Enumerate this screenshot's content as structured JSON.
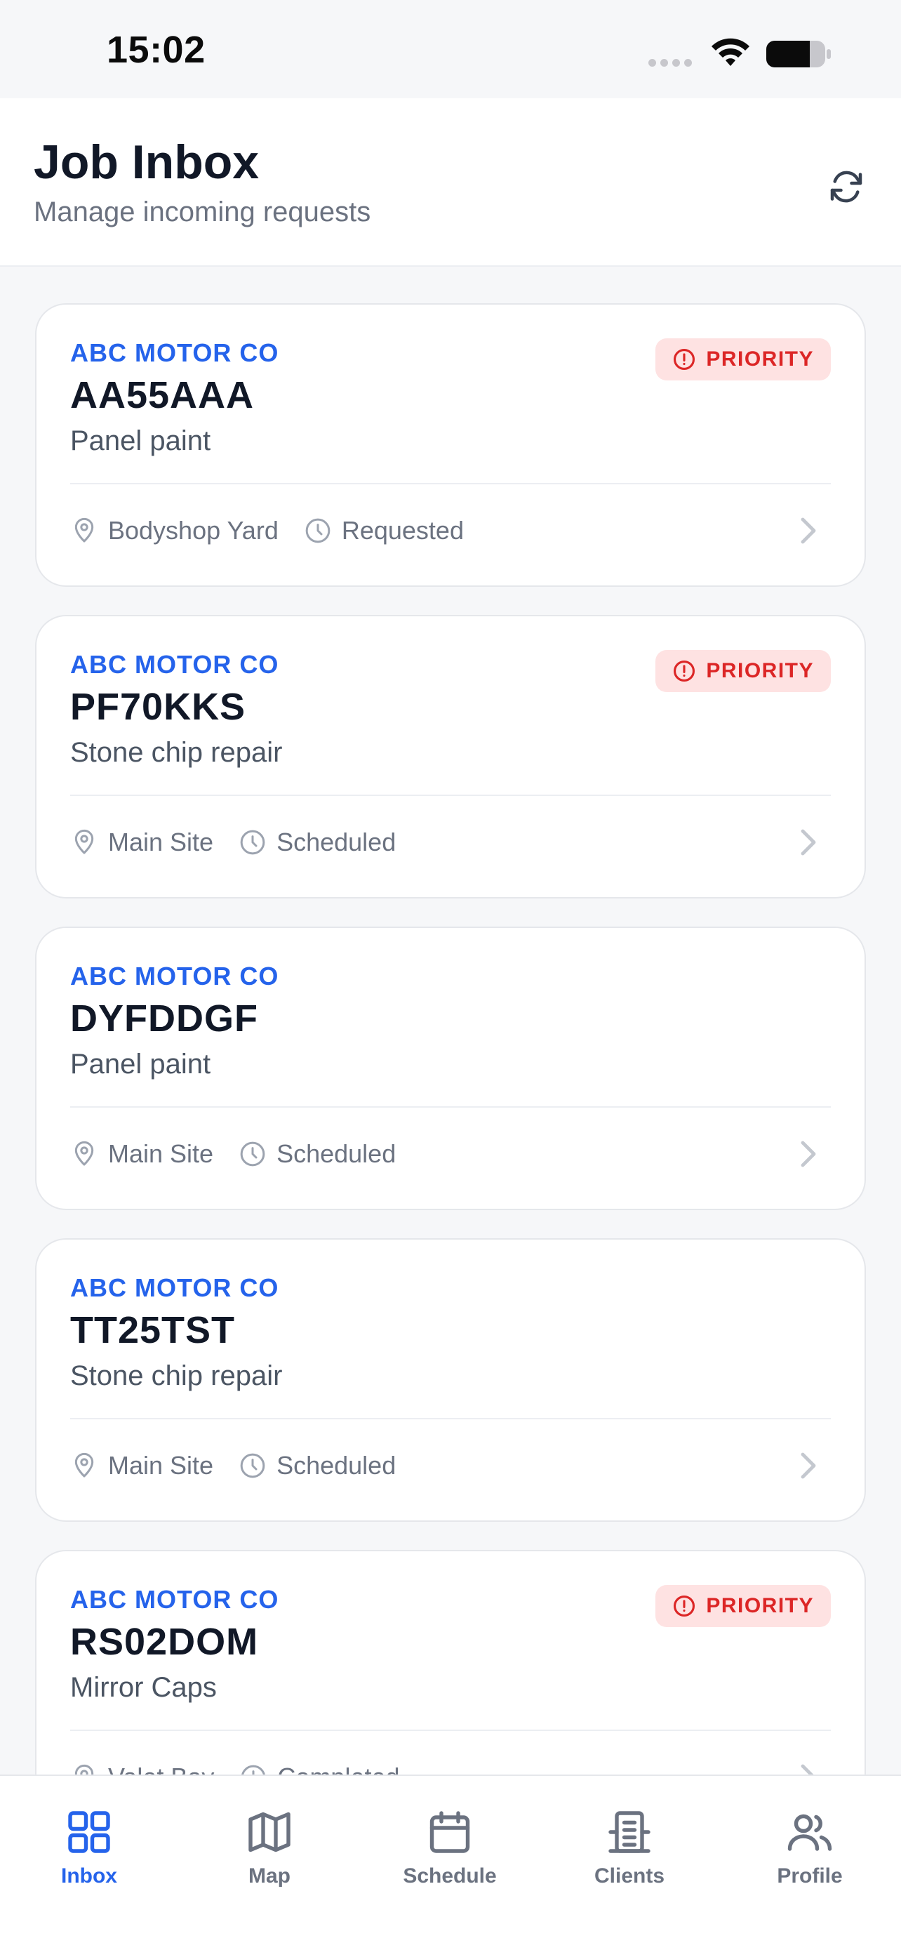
{
  "status_bar": {
    "time": "15:02"
  },
  "header": {
    "title": "Job Inbox",
    "subtitle": "Manage incoming requests",
    "refresh_icon": "refresh-icon"
  },
  "jobs": [
    {
      "client": "ABC MOTOR CO",
      "plate": "AA55AAA",
      "type": "Panel paint",
      "priority": true,
      "priority_label": "PRIORITY",
      "location": "Bodyshop Yard",
      "status": "Requested"
    },
    {
      "client": "ABC MOTOR CO",
      "plate": "PF70KKS",
      "type": "Stone chip repair",
      "priority": true,
      "priority_label": "PRIORITY",
      "location": "Main Site",
      "status": "Scheduled"
    },
    {
      "client": "ABC MOTOR CO",
      "plate": "DYFDDGF",
      "type": "Panel paint",
      "priority": false,
      "location": "Main Site",
      "status": "Scheduled"
    },
    {
      "client": "ABC MOTOR CO",
      "plate": "TT25TST",
      "type": "Stone chip repair",
      "priority": false,
      "location": "Main Site",
      "status": "Scheduled"
    },
    {
      "client": "ABC MOTOR CO",
      "plate": "RS02DOM",
      "type": "Mirror Caps",
      "priority": true,
      "priority_label": "PRIORITY",
      "location": "Valet Bay",
      "status": "Completed"
    }
  ],
  "tab_bar": {
    "tabs": [
      {
        "label": "Inbox",
        "icon": "grid-icon",
        "active": true
      },
      {
        "label": "Map",
        "icon": "map-icon",
        "active": false
      },
      {
        "label": "Schedule",
        "icon": "calendar-icon",
        "active": false
      },
      {
        "label": "Clients",
        "icon": "building-icon",
        "active": false
      },
      {
        "label": "Profile",
        "icon": "users-icon",
        "active": false
      }
    ]
  },
  "colors": {
    "accent": "#2563eb",
    "priority_text": "#dc2626",
    "priority_bg": "#fee2e2",
    "muted_text": "#6b7280"
  }
}
